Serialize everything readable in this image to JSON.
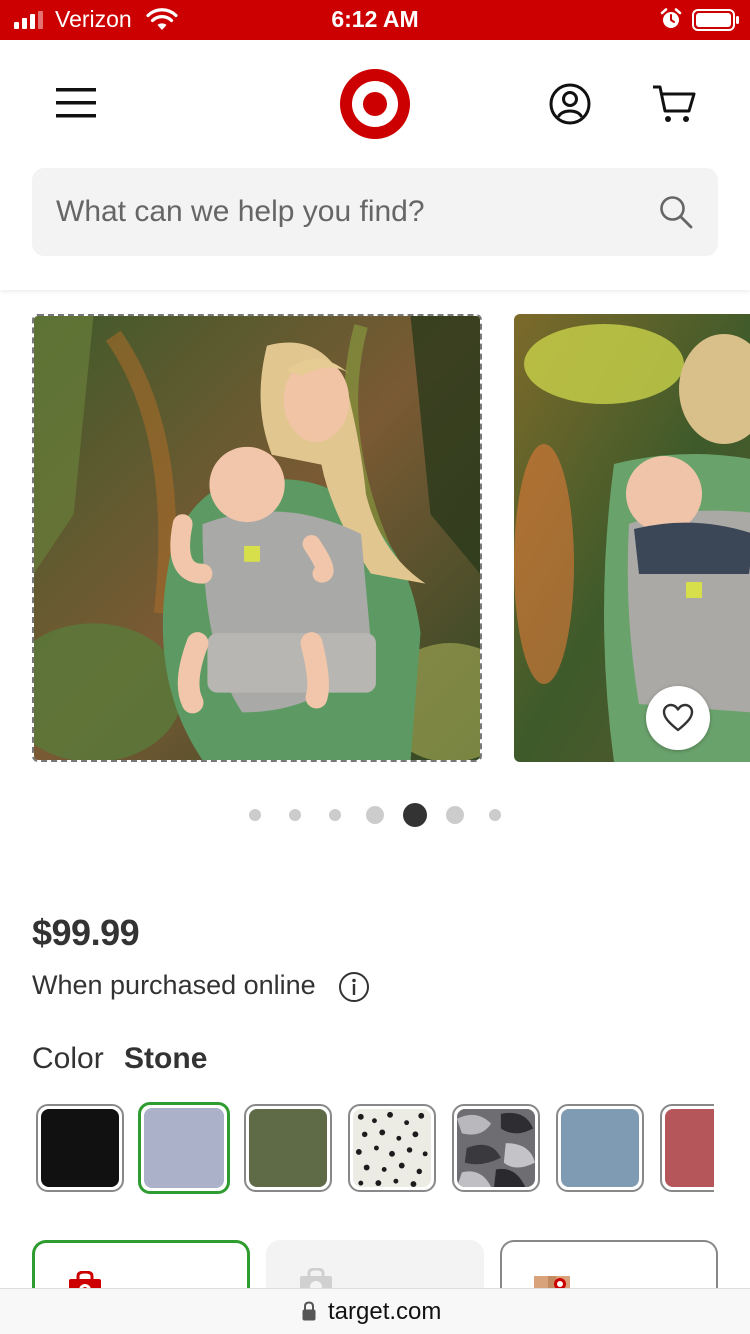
{
  "status_bar": {
    "carrier": "Verizon",
    "time": "6:12 AM",
    "icons": [
      "signal-icon",
      "wifi-icon",
      "alarm-icon",
      "battery-icon"
    ]
  },
  "header": {
    "icons": [
      "menu-icon",
      "target-logo",
      "account-icon",
      "cart-icon"
    ],
    "search": {
      "placeholder": "What can we help you find?",
      "value": "",
      "icon": "search-icon"
    }
  },
  "carousel": {
    "slide_count": 7,
    "active_index": 4,
    "favorite_icon": "heart-icon"
  },
  "product": {
    "price": "$99.99",
    "price_note": "When purchased online",
    "info_icon": "info-icon",
    "color_label": "Color",
    "color_value": "Stone",
    "swatches": [
      {
        "color": "#111111",
        "selected": false
      },
      {
        "color": "#aab1c9",
        "selected": true
      },
      {
        "color": "#5e6b46",
        "selected": false
      },
      {
        "pattern": "leopard",
        "selected": false
      },
      {
        "pattern": "camo-gray",
        "selected": false
      },
      {
        "color": "#7f9ab3",
        "selected": false
      },
      {
        "color": "#b4565a",
        "selected": false
      }
    ]
  },
  "fulfillment": {
    "icons": [
      "pickup-bag-icon",
      "drive-up-icon",
      "shipping-box-icon"
    ]
  },
  "browser": {
    "url": "target.com",
    "lock_icon": "lock-icon"
  },
  "colors": {
    "brand_red": "#cc0000",
    "selected_green": "#2e9c2e"
  }
}
